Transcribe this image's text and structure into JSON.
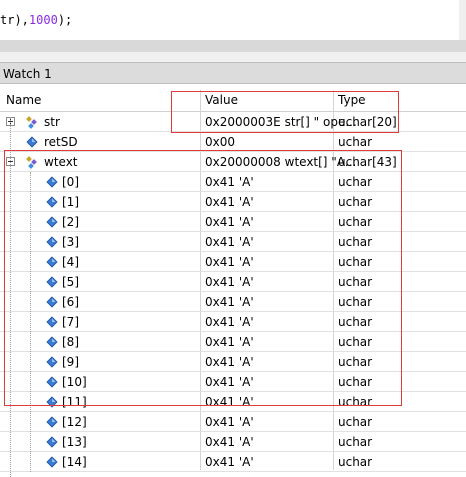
{
  "code_line": {
    "pre": "tr),",
    "num": "1000",
    "post": ");"
  },
  "panel": {
    "title": "Watch 1"
  },
  "columns": {
    "name": "Name",
    "value": "Value",
    "type": "Type"
  },
  "rows": [
    {
      "name": "str",
      "value": "0x2000003E str[] \" ope...",
      "type": "uchar[20]",
      "kind": "struct",
      "expander": "plus"
    },
    {
      "name": "retSD",
      "value": "0x00",
      "type": "uchar",
      "kind": "var",
      "expander": ""
    },
    {
      "name": "wtext",
      "value": "0x20000008 wtext[] \"A...",
      "type": "uchar[43]",
      "kind": "struct",
      "expander": "minus"
    },
    {
      "name": "[0]",
      "value": "0x41 'A'",
      "type": "uchar",
      "kind": "var",
      "expander": ""
    },
    {
      "name": "[1]",
      "value": "0x41 'A'",
      "type": "uchar",
      "kind": "var",
      "expander": ""
    },
    {
      "name": "[2]",
      "value": "0x41 'A'",
      "type": "uchar",
      "kind": "var",
      "expander": ""
    },
    {
      "name": "[3]",
      "value": "0x41 'A'",
      "type": "uchar",
      "kind": "var",
      "expander": ""
    },
    {
      "name": "[4]",
      "value": "0x41 'A'",
      "type": "uchar",
      "kind": "var",
      "expander": ""
    },
    {
      "name": "[5]",
      "value": "0x41 'A'",
      "type": "uchar",
      "kind": "var",
      "expander": ""
    },
    {
      "name": "[6]",
      "value": "0x41 'A'",
      "type": "uchar",
      "kind": "var",
      "expander": ""
    },
    {
      "name": "[7]",
      "value": "0x41 'A'",
      "type": "uchar",
      "kind": "var",
      "expander": ""
    },
    {
      "name": "[8]",
      "value": "0x41 'A'",
      "type": "uchar",
      "kind": "var",
      "expander": ""
    },
    {
      "name": "[9]",
      "value": "0x41 'A'",
      "type": "uchar",
      "kind": "var",
      "expander": ""
    },
    {
      "name": "[10]",
      "value": "0x41 'A'",
      "type": "uchar",
      "kind": "var",
      "expander": ""
    },
    {
      "name": "[11]",
      "value": "0x41 'A'",
      "type": "uchar",
      "kind": "var",
      "expander": ""
    },
    {
      "name": "[12]",
      "value": "0x41 'A'",
      "type": "uchar",
      "kind": "var",
      "expander": ""
    },
    {
      "name": "[13]",
      "value": "0x41 'A'",
      "type": "uchar",
      "kind": "var",
      "expander": ""
    },
    {
      "name": "[14]",
      "value": "0x41 'A'",
      "type": "uchar",
      "kind": "var",
      "expander": ""
    }
  ],
  "colors": {
    "highlight": "#e03a3a",
    "number": "#8a2be2"
  }
}
